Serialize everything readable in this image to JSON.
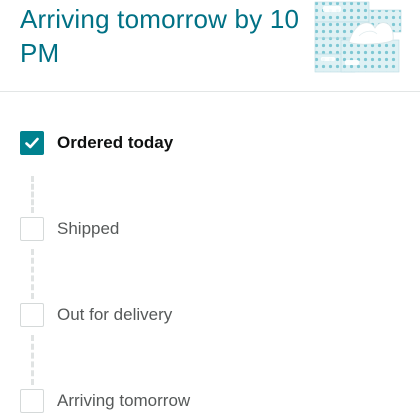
{
  "delivery": {
    "headline": "Arriving tomorrow by 10 PM"
  },
  "product": {
    "image_icon": "tissue-box-pack-image"
  },
  "tracker": {
    "steps": [
      {
        "label": "Ordered today",
        "status": "complete"
      },
      {
        "label": "Shipped",
        "status": "pending"
      },
      {
        "label": "Out for delivery",
        "status": "pending"
      },
      {
        "label": "Arriving tomorrow",
        "status": "pending"
      }
    ],
    "colors": {
      "accent": "#007185",
      "check": "#00828f",
      "pending_border": "#d5d9d9",
      "connector": "#e0e3e3"
    }
  }
}
